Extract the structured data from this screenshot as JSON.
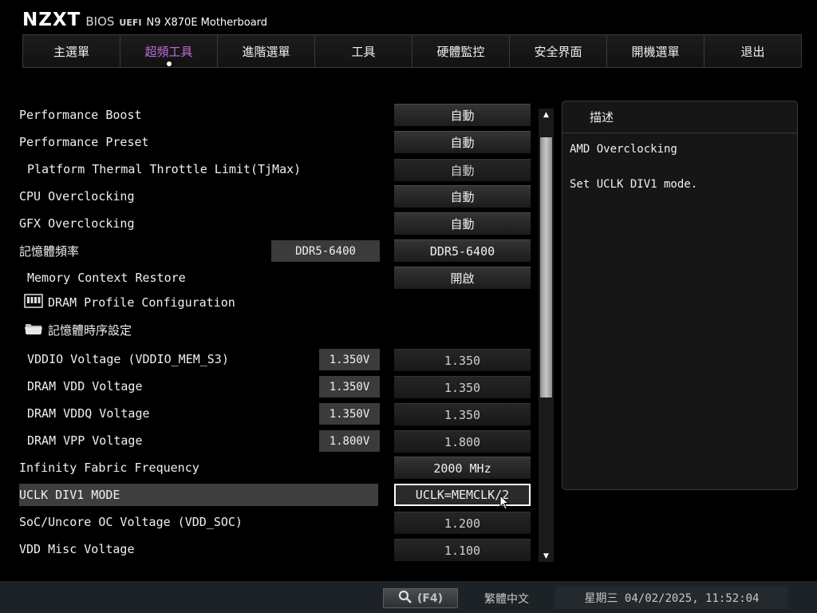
{
  "header": {
    "logo": "NZXT",
    "bios": "BIOS",
    "uefi": "UEFI",
    "model": "N9 X870E Motherboard"
  },
  "tabs": [
    {
      "label": "主選單",
      "active": false
    },
    {
      "label": "超頻工具",
      "active": true
    },
    {
      "label": "進階選單",
      "active": false
    },
    {
      "label": "工具",
      "active": false
    },
    {
      "label": "硬體監控",
      "active": false
    },
    {
      "label": "安全界面",
      "active": false
    },
    {
      "label": "開機選單",
      "active": false
    },
    {
      "label": "退出",
      "active": false
    }
  ],
  "settings": [
    {
      "label": "Performance Boost",
      "value": "自動"
    },
    {
      "label": "Performance Preset",
      "value": "自動"
    },
    {
      "label": "Platform Thermal Throttle Limit(TjMax)",
      "value": "自動"
    },
    {
      "label": "CPU Overclocking",
      "value": "自動"
    },
    {
      "label": "GFX Overclocking",
      "value": "自動"
    },
    {
      "label": "記憶體頻率",
      "current": "DDR5-6400",
      "value": "DDR5-6400"
    },
    {
      "label": "Memory Context Restore",
      "value": "開啟"
    },
    {
      "label": "DRAM Profile Configuration",
      "icon": "memory-module-icon"
    },
    {
      "label": "記憶體時序設定",
      "icon": "folder-icon"
    },
    {
      "label": "VDDIO Voltage (VDDIO_MEM_S3)",
      "current": "1.350V",
      "value": "1.350"
    },
    {
      "label": "DRAM VDD Voltage",
      "current": "1.350V",
      "value": "1.350"
    },
    {
      "label": "DRAM VDDQ Voltage",
      "current": "1.350V",
      "value": "1.350"
    },
    {
      "label": "DRAM VPP Voltage",
      "current": "1.800V",
      "value": "1.800"
    },
    {
      "label": "Infinity Fabric Frequency",
      "value": "2000 MHz"
    },
    {
      "label": "UCLK DIV1 MODE",
      "value": "UCLK=MEMCLK/2",
      "selected": true
    },
    {
      "label": "SoC/Uncore OC Voltage (VDD_SOC)",
      "value": "1.200"
    },
    {
      "label": "VDD Misc Voltage",
      "value": "1.100"
    }
  ],
  "scrollbar": {
    "up_arrow": "▲",
    "down_arrow": "▼"
  },
  "description": {
    "title": "描述",
    "line1": "AMD Overclocking",
    "line2": "Set UCLK DIV1 mode."
  },
  "footer": {
    "search_key": "(F4)",
    "language": "繁體中文",
    "datetime": "星期三 04/02/2025, 11:52:04"
  },
  "colors": {
    "background": "#000000",
    "active_tab": "#c06ad8",
    "selected_row": "#3e3e3e",
    "footer": "#1c2225"
  }
}
